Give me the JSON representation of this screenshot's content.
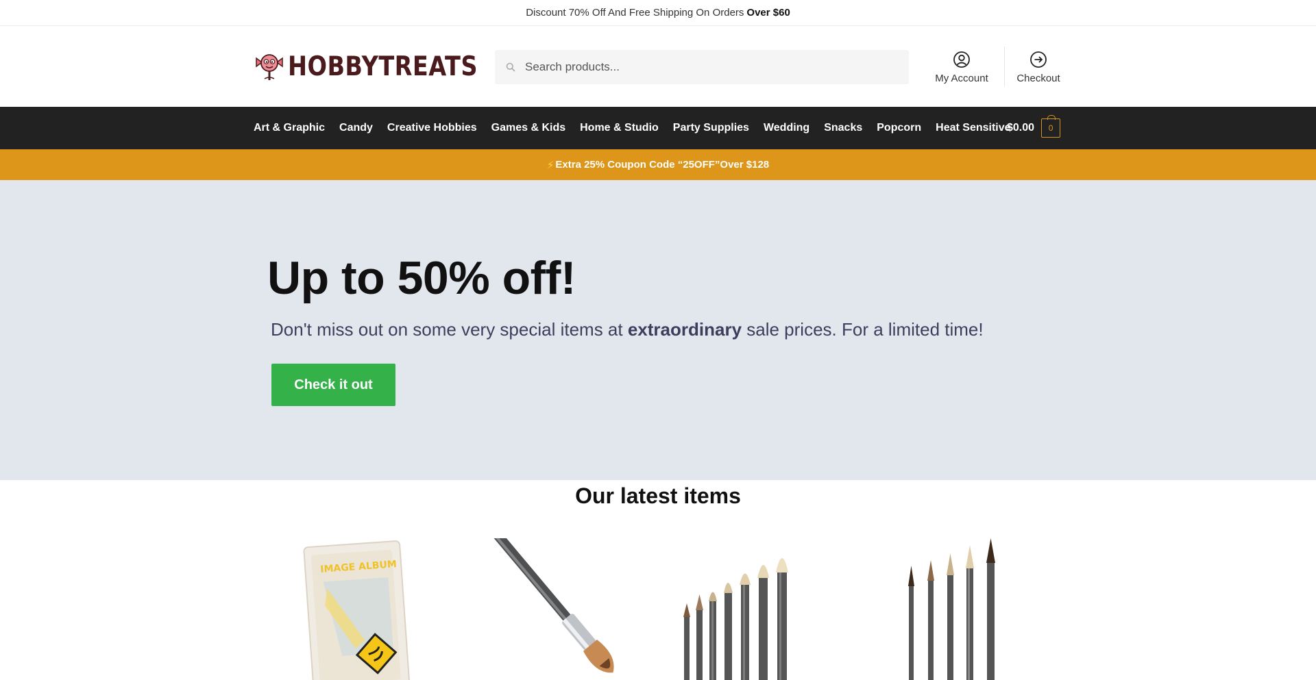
{
  "topbar": {
    "text": "Discount 70% Off And Free Shipping On Orders",
    "bold": "Over $60"
  },
  "header": {
    "logo_text": "HOBBYTREATS",
    "search_placeholder": "Search products...",
    "account_label": "My Account",
    "checkout_label": "Checkout"
  },
  "nav": {
    "items": [
      "Art & Graphic",
      "Candy",
      "Creative Hobbies",
      "Games & Kids",
      "Home & Studio",
      "Party Supplies",
      "Wedding",
      "Snacks",
      "Popcorn",
      "Heat Sensitive"
    ],
    "cart_total": "$0.00",
    "cart_count": "0"
  },
  "promo": {
    "icon": "⚡",
    "text": "Extra 25% Coupon Code “25OFF”Over $128"
  },
  "hero": {
    "headline": "Up to 50% off!",
    "sub_before": "Don't miss out on some very special items at",
    "sub_bold": "extraordinary",
    "sub_after": "sale prices. For a limited time!",
    "cta_label": "Check it out"
  },
  "latest": {
    "title": "Our latest items",
    "products": [
      {
        "image": "image-album-icon"
      },
      {
        "image": "foundation-brush-icon"
      },
      {
        "image": "brush-set-icon"
      },
      {
        "image": "fine-brush-set-icon"
      }
    ]
  },
  "colors": {
    "nav_bg": "#222222",
    "promo_bg": "#de961a",
    "hero_bg": "#e2e6ed",
    "cta_bg": "#34b249",
    "logo_text": "#4a1a1c"
  }
}
